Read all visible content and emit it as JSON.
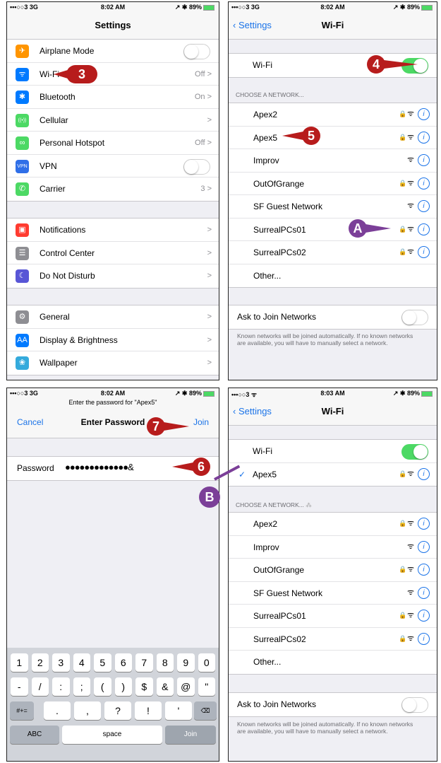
{
  "status_bar": {
    "carrier": "•••○○3 3G",
    "time_1": "8:02 AM",
    "time_2": "8:03 AM",
    "right": "↗ ✱ 89%",
    "carrier_wifi": "•••○○3 ᯤ"
  },
  "settings": {
    "title": "Settings",
    "group1": [
      {
        "label": "Airplane Mode",
        "value": "",
        "icon": "airplane-icon",
        "color": "#ff9500",
        "glyph": "✈"
      },
      {
        "label": "Wi-Fi",
        "value": "Off >",
        "icon": "wifi-icon",
        "color": "#007aff",
        "glyph": "ᯤ"
      },
      {
        "label": "Bluetooth",
        "value": "On >",
        "icon": "bluetooth-icon",
        "color": "#007aff",
        "glyph": "✱"
      },
      {
        "label": "Cellular",
        "value": ">",
        "icon": "cellular-icon",
        "color": "#4cd964",
        "glyph": "((•))"
      },
      {
        "label": "Personal Hotspot",
        "value": "Off >",
        "icon": "hotspot-icon",
        "color": "#4cd964",
        "glyph": "∞"
      },
      {
        "label": "VPN",
        "value": "",
        "icon": "vpn-icon",
        "color": "#2f6fe8",
        "glyph": "VPN"
      },
      {
        "label": "Carrier",
        "value": "3 >",
        "icon": "phone-icon",
        "color": "#4cd964",
        "glyph": "✆"
      }
    ],
    "group2": [
      {
        "label": "Notifications",
        "value": ">",
        "icon": "notifications-icon",
        "color": "#ff3b30",
        "glyph": "▣"
      },
      {
        "label": "Control Center",
        "value": ">",
        "icon": "control-center-icon",
        "color": "#8e8e93",
        "glyph": "☰"
      },
      {
        "label": "Do Not Disturb",
        "value": ">",
        "icon": "moon-icon",
        "color": "#5856d6",
        "glyph": "☾"
      }
    ],
    "group3": [
      {
        "label": "General",
        "value": ">",
        "icon": "gear-icon",
        "color": "#8e8e93",
        "glyph": "⚙"
      },
      {
        "label": "Display & Brightness",
        "value": ">",
        "icon": "display-icon",
        "color": "#007aff",
        "glyph": "AA"
      },
      {
        "label": "Wallpaper",
        "value": ">",
        "icon": "wallpaper-icon",
        "color": "#34aadc",
        "glyph": "❀"
      }
    ]
  },
  "wifi_off": {
    "back": "Settings",
    "title": "Wi-Fi",
    "wifi_label": "Wi-Fi",
    "choose_header": "CHOOSE A NETWORK...",
    "networks": [
      {
        "name": "Apex2",
        "lock": "🔒"
      },
      {
        "name": "Apex5",
        "lock": "🔒"
      },
      {
        "name": "Improv",
        "lock": ""
      },
      {
        "name": "OutOfGrange",
        "lock": "🔒"
      },
      {
        "name": "SF Guest Network",
        "lock": ""
      },
      {
        "name": "SurrealPCs01",
        "lock": "🔒"
      },
      {
        "name": "SurrealPCs02",
        "lock": "🔒"
      },
      {
        "name": "Other...",
        "lock": ""
      }
    ],
    "ask_label": "Ask to Join Networks",
    "footer": "Known networks will be joined automatically. If no known networks are available, you will have to manually select a network."
  },
  "password": {
    "prompt": "Enter the password for \"Apex5\"",
    "cancel": "Cancel",
    "title": "Enter Password",
    "join": "Join",
    "field_label": "Password",
    "field_value": "●●●●●●●●●●●●●&"
  },
  "keyboard": {
    "row1": [
      "1",
      "2",
      "3",
      "4",
      "5",
      "6",
      "7",
      "8",
      "9",
      "0"
    ],
    "row2": [
      "-",
      "/",
      ":",
      ";",
      "(",
      ")",
      "$",
      "&",
      "@",
      "\""
    ],
    "row3": [
      "#+=",
      ".",
      ",",
      "?",
      "!",
      "'",
      "⌫"
    ],
    "row4": [
      "ABC",
      "space",
      "Join"
    ]
  },
  "wifi_connected": {
    "back": "Settings",
    "title": "Wi-Fi",
    "wifi_label": "Wi-Fi",
    "connected": "Apex5",
    "check": "✓",
    "choose_header": "CHOOSE A NETWORK...",
    "networks": [
      {
        "name": "Apex2",
        "lock": "🔒"
      },
      {
        "name": "Improv",
        "lock": ""
      },
      {
        "name": "OutOfGrange",
        "lock": "🔒"
      },
      {
        "name": "SF Guest Network",
        "lock": ""
      },
      {
        "name": "SurrealPCs01",
        "lock": "🔒"
      },
      {
        "name": "SurrealPCs02",
        "lock": "🔒"
      },
      {
        "name": "Other...",
        "lock": ""
      }
    ],
    "ask_label": "Ask to Join Networks",
    "footer": "Known networks will be joined automatically. If no known networks are available, you will have to manually select a network."
  },
  "callouts": {
    "c3": "3",
    "c4": "4",
    "c5": "5",
    "c6": "6",
    "c7": "7",
    "cA": "A",
    "cB": "B"
  },
  "icons": {
    "wifi": "ᯤ",
    "info": "i",
    "chev": ">"
  }
}
